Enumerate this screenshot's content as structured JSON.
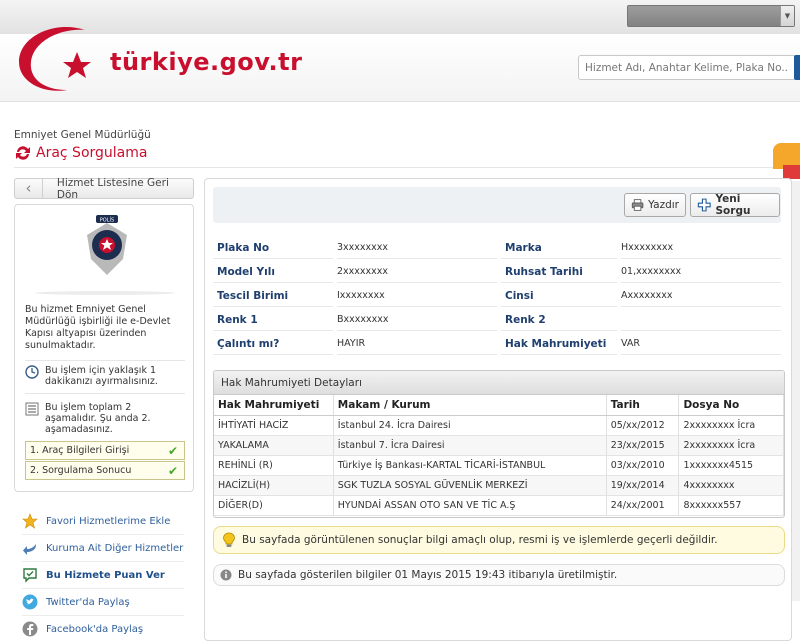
{
  "header": {
    "brand": "türkiye.gov.tr",
    "search_placeholder": "Hizmet Adı, Anahtar Kelime, Plaka No..."
  },
  "page": {
    "org": "Emniyet Genel Müdürlüğü",
    "title": "Araç Sorgulama"
  },
  "sidebar": {
    "back_label": "Hizmet Listesine Geri Dön",
    "description": "Bu hizmet Emniyet Genel Müdürlüğü işbirliği ile e-Devlet Kapısı altyapısı üzerinden sunulmaktadır.",
    "duration_note": "Bu işlem için yaklaşık 1 dakikanızı ayırmalısınız.",
    "steps_note": "Bu işlem toplam 2 aşamalıdır. Şu anda 2. aşamadasınız.",
    "steps": [
      {
        "label": "1. Araç Bilgileri Girişi"
      },
      {
        "label": "2. Sorgulama Sonucu"
      }
    ],
    "links": [
      {
        "label": "Favori Hizmetlerime Ekle"
      },
      {
        "label": "Kuruma Ait Diğer Hizmetler"
      },
      {
        "label": "Bu Hizmete Puan Ver"
      },
      {
        "label": "Twitter'da Paylaş"
      },
      {
        "label": "Facebook'da Paylaş"
      }
    ]
  },
  "toolbar": {
    "print_label": "Yazdır",
    "new_query_label": "Yeni Sorgu"
  },
  "details": [
    {
      "label": "Plaka No",
      "value": "3xxxxxxxx",
      "label2": "Marka",
      "value2": "Hxxxxxxxx"
    },
    {
      "label": "Model Yılı",
      "value": "2xxxxxxxx",
      "label2": "Ruhsat Tarihi",
      "value2": "01,xxxxxxxx"
    },
    {
      "label": "Tescil Birimi",
      "value": "Ixxxxxxxx",
      "label2": "Cinsi",
      "value2": "Axxxxxxxx"
    },
    {
      "label": "Renk 1",
      "value": "Bxxxxxxxx",
      "label2": "Renk 2",
      "value2": ""
    },
    {
      "label": "Çalıntı mı?",
      "value": "HAYIR",
      "label2": "Hak Mahrumiyeti",
      "value2": "VAR"
    }
  ],
  "hak": {
    "title": "Hak Mahrumiyeti Detayları",
    "headers": [
      "Hak Mahrumiyeti",
      "Makam / Kurum",
      "Tarih",
      "Dosya No"
    ],
    "rows": [
      [
        "İHTİYATİ HACİZ",
        "İstanbul 24. İcra Dairesi",
        "05/xx/2012",
        "2xxxxxxxx İcra"
      ],
      [
        "YAKALAMA",
        "İstanbul 7. İcra Dairesi",
        "23/xx/2015",
        "2xxxxxxxx İcra"
      ],
      [
        "REHİNLİ (R)",
        "Türkiye İş Bankası-KARTAL TİCARİ-İSTANBUL",
        "03/xx/2010",
        "1xxxxxxx4515"
      ],
      [
        "HACİZLİ(H)",
        "SGK TUZLA SOSYAL GÜVENLİK MERKEZİ",
        "19/xx/2014",
        "4xxxxxxxx"
      ],
      [
        "DİĞER(D)",
        "HYUNDAİ ASSAN OTO SAN VE TİC A.Ş",
        "24/xx/2001",
        "8xxxxxx557"
      ]
    ]
  },
  "notice": "Bu sayfada görüntülenen sonuçlar bilgi amaçlı olup, resmi iş ve işlemlerde geçerli değildir.",
  "generated": "Bu sayfada gösterilen bilgiler 01 Mayıs 2015 19:43 itibarıyla üretilmiştir.",
  "colors": {
    "brand_red": "#c8102e",
    "label_blue": "#1f3f6e",
    "link_blue": "#2f5f9c",
    "check_green": "#4aa52e"
  }
}
